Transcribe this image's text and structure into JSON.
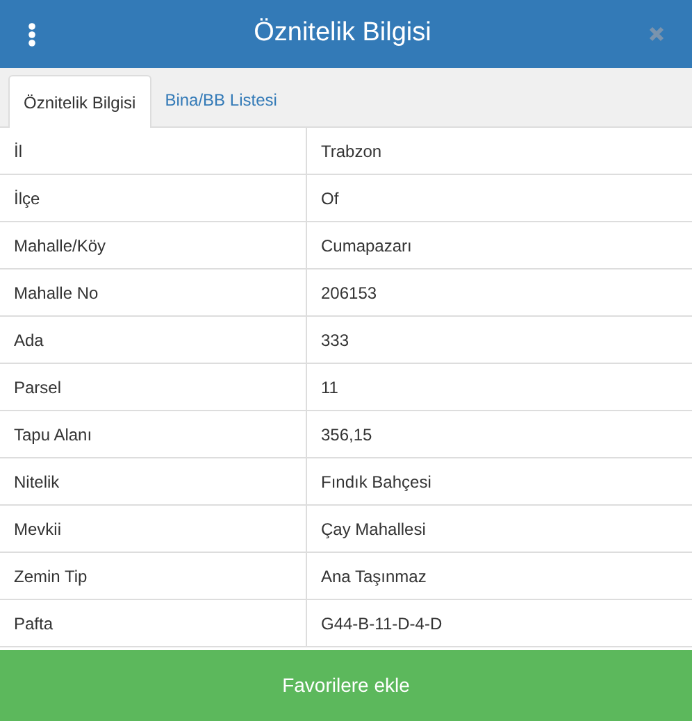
{
  "header": {
    "title": "Öznitelik Bilgisi"
  },
  "tabs": [
    {
      "label": "Öznitelik Bilgisi",
      "selected": true
    },
    {
      "label": "Bina/BB Listesi",
      "selected": false
    }
  ],
  "table": {
    "rows": [
      {
        "label": "İl",
        "value": "Trabzon"
      },
      {
        "label": "İlçe",
        "value": "Of"
      },
      {
        "label": "Mahalle/Köy",
        "value": "Cumapazarı"
      },
      {
        "label": "Mahalle No",
        "value": "206153"
      },
      {
        "label": "Ada",
        "value": "333"
      },
      {
        "label": "Parsel",
        "value": "11"
      },
      {
        "label": "Tapu Alanı",
        "value": "356,15"
      },
      {
        "label": "Nitelik",
        "value": "Fındık Bahçesi"
      },
      {
        "label": "Mevkii",
        "value": "Çay Mahallesi"
      },
      {
        "label": "Zemin Tip",
        "value": "Ana Taşınmaz"
      },
      {
        "label": "Pafta",
        "value": "G44-B-11-D-4-D"
      }
    ]
  },
  "footer_button": "Favorilere ekle"
}
